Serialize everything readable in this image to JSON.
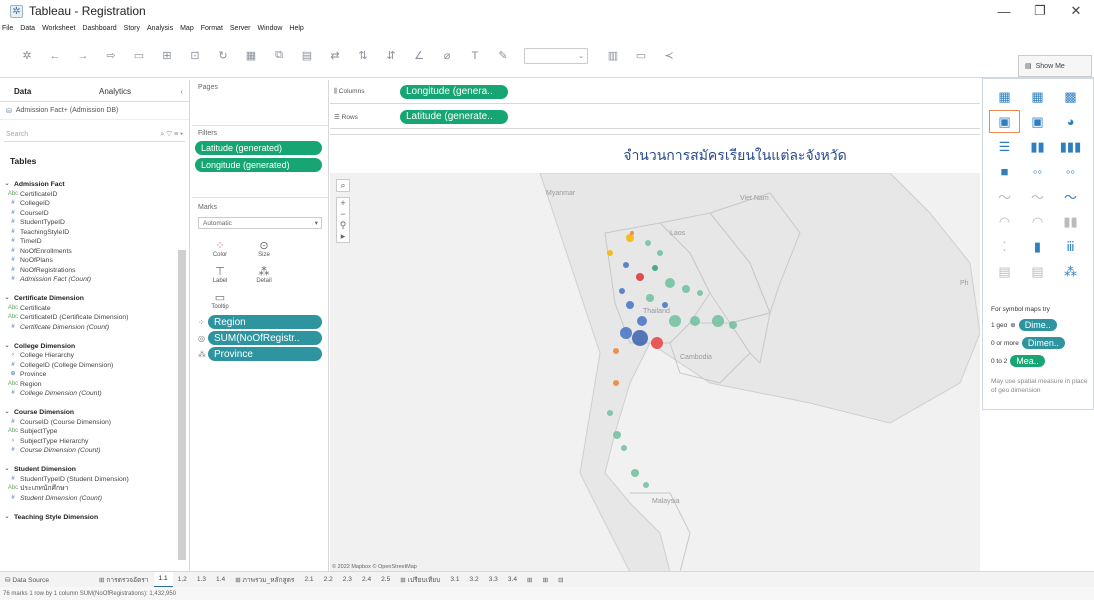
{
  "window": {
    "title": "Tableau - Registration"
  },
  "menu": [
    "File",
    "Data",
    "Worksheet",
    "Dashboard",
    "Story",
    "Analysis",
    "Map",
    "Format",
    "Server",
    "Window",
    "Help"
  ],
  "showme": {
    "label": "Show Me",
    "for_text": "For symbol maps try",
    "geo_count": "1 geo",
    "geo_pill": "Dime..",
    "dim_count": "0 or more",
    "dim_pill": "Dimen..",
    "meas_count": "0 to 2",
    "meas_pill": "Mea..",
    "hint": "May use spatial measure in place of geo dimension"
  },
  "left": {
    "tab_data": "Data",
    "tab_analytics": "Analytics",
    "datasource": "Admission Fact+ (Admission DB)",
    "search_placeholder": "Search",
    "tables_heading": "Tables"
  },
  "tree": [
    {
      "t": "Admission Fact",
      "grp": true,
      "i": "v"
    },
    {
      "t": "CertificateID",
      "i": "Abc"
    },
    {
      "t": "CollegeID",
      "i": "#"
    },
    {
      "t": "CourseID",
      "i": "#"
    },
    {
      "t": "StudentTypeID",
      "i": "#"
    },
    {
      "t": "TeachingStyleID",
      "i": "#"
    },
    {
      "t": "TimeID",
      "i": "#"
    },
    {
      "t": "NoOfEnrollments",
      "i": "#"
    },
    {
      "t": "NoOfPlans",
      "i": "#"
    },
    {
      "t": "NoOfRegistrations",
      "i": "#"
    },
    {
      "t": "Admission Fact (Count)",
      "i": "#",
      "it": true
    },
    {
      "t": "",
      "i": ""
    },
    {
      "t": "Certificate Dimension",
      "grp": true,
      "i": "v"
    },
    {
      "t": "Certificate",
      "i": "Abc"
    },
    {
      "t": "CertificateID (Certificate Dimension)",
      "i": "Abc"
    },
    {
      "t": "Certificate Dimension (Count)",
      "i": "#",
      "it": true
    },
    {
      "t": "",
      "i": ""
    },
    {
      "t": "College Dimension",
      "grp": true,
      "i": "v"
    },
    {
      "t": "College Hierarchy",
      "i": "›"
    },
    {
      "t": "CollegeID (College Dimension)",
      "i": "#"
    },
    {
      "t": "Province",
      "i": "⊕"
    },
    {
      "t": "Region",
      "i": "Abc"
    },
    {
      "t": "College Dimension (Count)",
      "i": "#",
      "it": true
    },
    {
      "t": "",
      "i": ""
    },
    {
      "t": "Course Dimension",
      "grp": true,
      "i": "v"
    },
    {
      "t": "CourseID (Course Dimension)",
      "i": "#"
    },
    {
      "t": "SubjectType",
      "i": "Abc"
    },
    {
      "t": "SubjectType Hierarchy",
      "i": "›"
    },
    {
      "t": "Course Dimension (Count)",
      "i": "#",
      "it": true
    },
    {
      "t": "",
      "i": ""
    },
    {
      "t": "Student Dimension",
      "grp": true,
      "i": "v"
    },
    {
      "t": "StudentTypeID (Student Dimension)",
      "i": "#"
    },
    {
      "t": "ประเภทนักศึกษา",
      "i": "Abc"
    },
    {
      "t": "Student Dimension (Count)",
      "i": "#",
      "it": true
    },
    {
      "t": "",
      "i": ""
    },
    {
      "t": "Teaching Style Dimension",
      "grp": true,
      "i": "v"
    }
  ],
  "cards": {
    "pages": "Pages",
    "filters": "Filters",
    "filter1": "Latitude (generated)",
    "filter2": "Longitude (generated)",
    "marks": "Marks",
    "marks_type": "Automatic",
    "color": "Color",
    "size": "Size",
    "label": "Label",
    "detail": "Detail",
    "tooltip": "Tooltip",
    "pill_region": "Region",
    "pill_sum": "SUM(NoOfRegistr..",
    "pill_province": "Province"
  },
  "shelves": {
    "columns_label": "Columns",
    "rows_label": "Rows",
    "columns_pill": "Longitude (genera..",
    "rows_pill": "Latitude (generate.."
  },
  "view": {
    "title": "จำนวนการสมัครเรียนในแต่ละจังหวัด",
    "attribution": "© 2022 Mapbox © OpenStreetMap",
    "labels": {
      "myanmar": "Myanmar",
      "vietnam": "Viet Nam",
      "laos": "Laos",
      "thailand": "Thailand",
      "cambodia": "Cambodia",
      "malaysia": "Malaysia",
      "ph": "Ph"
    }
  },
  "sheets": {
    "datasource": "Data Source",
    "s1": "การตรวจอัตรา",
    "s2": "1.1",
    "s3": "1.2",
    "s4": "1.3",
    "s5": "1.4",
    "s6": "ภาพรวม_หลักสูตร",
    "s7": "2.1",
    "s8": "2.2",
    "s9": "2.3",
    "s10": "2.4",
    "s11": "2.5",
    "s12": "เปรียบเทียบ",
    "s13": "3.1",
    "s14": "3.2",
    "s15": "3.3",
    "s16": "3.4"
  },
  "status": {
    "text": "76 marks   1 row by 1 column   SUM(NoOfRegistrations): 1,432,950"
  },
  "colors": {
    "green": "#17a673",
    "teal": "#2e94a0"
  }
}
